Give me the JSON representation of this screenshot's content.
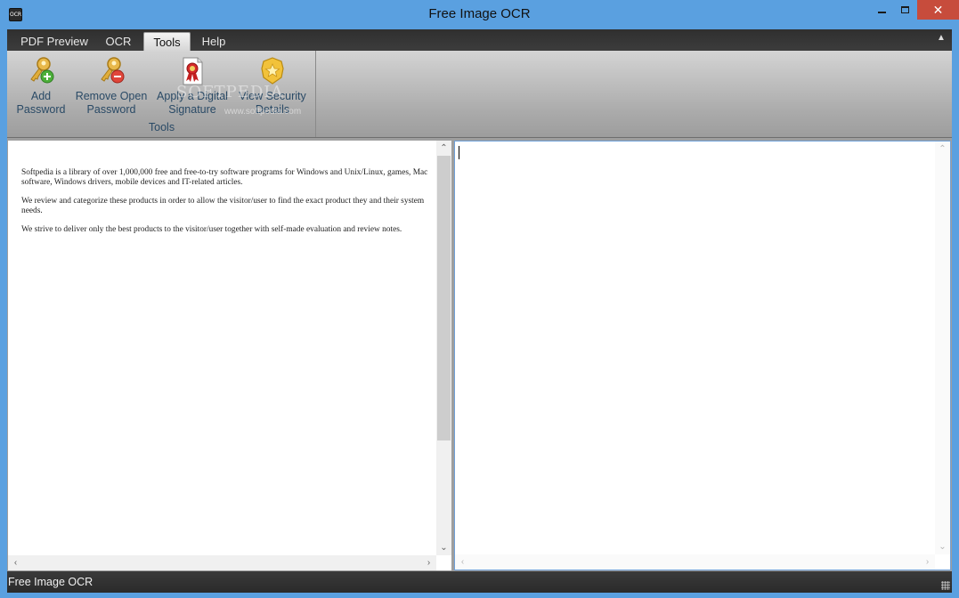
{
  "window": {
    "title": "Free Image OCR",
    "app_icon_label": "OCR"
  },
  "tabs": [
    {
      "label": "PDF Preview",
      "active": false
    },
    {
      "label": "OCR",
      "active": false
    },
    {
      "label": "Tools",
      "active": true
    },
    {
      "label": "Help",
      "active": false
    }
  ],
  "ribbon": {
    "buttons": [
      {
        "label_line1": "Add",
        "label_line2": "Password",
        "icon": "key-add-icon"
      },
      {
        "label_line1": "Remove Open",
        "label_line2": "Password",
        "icon": "key-remove-icon"
      },
      {
        "label_line1": "Apply a Digital",
        "label_line2": "Signature",
        "icon": "certificate-icon"
      },
      {
        "label_line1": "View Security",
        "label_line2": "Details",
        "icon": "security-badge-icon"
      }
    ],
    "group_label": "Tools",
    "watermark": "SOFTPEDIA",
    "watermark_url": "www.softpedia.com"
  },
  "document": {
    "paragraphs": [
      "Softpedia is a library of over 1,000,000 free and free-to-try software programs for Windows and Unix/Linux, games, Mac software, Windows drivers, mobile devices and IT-related articles.",
      "We review and categorize these products in order to allow the visitor/user to find the exact product they and their system needs.",
      "We strive to deliver only the best products to the visitor/user together with self-made evaluation and review notes."
    ]
  },
  "output_text": "",
  "status": {
    "text": "Free Image OCR"
  },
  "colors": {
    "title_bar": "#5aa0e0",
    "close_button": "#c74c3c",
    "ribbon_text": "#2a4a66",
    "status_bar": "#2f2f2f"
  }
}
